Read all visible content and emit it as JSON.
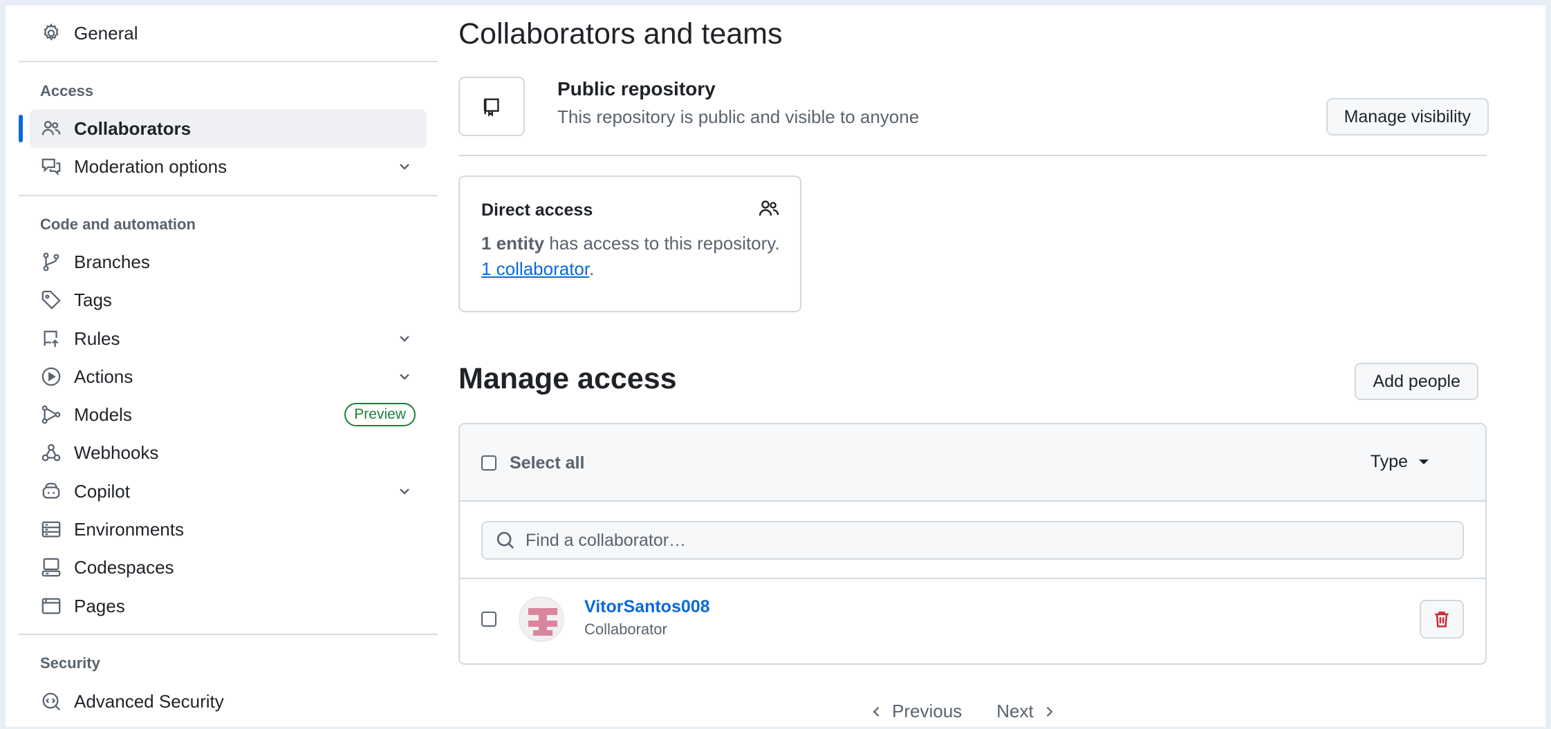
{
  "sidebar": {
    "general": {
      "label": "General",
      "icon": "gear-icon"
    },
    "sections": {
      "access": "Access",
      "code_automation": "Code and automation",
      "security": "Security"
    },
    "access_items": [
      {
        "label": "Collaborators",
        "icon": "people-icon",
        "active": true
      },
      {
        "label": "Moderation options",
        "icon": "comment-discussion-icon",
        "expandable": true
      }
    ],
    "code_items": [
      {
        "label": "Branches",
        "icon": "git-branch-icon"
      },
      {
        "label": "Tags",
        "icon": "tag-icon"
      },
      {
        "label": "Rules",
        "icon": "repo-push-icon",
        "expandable": true
      },
      {
        "label": "Actions",
        "icon": "play-icon",
        "expandable": true
      },
      {
        "label": "Models",
        "icon": "workflow-icon",
        "badge": "Preview"
      },
      {
        "label": "Webhooks",
        "icon": "webhook-icon"
      },
      {
        "label": "Copilot",
        "icon": "copilot-icon",
        "expandable": true
      },
      {
        "label": "Environments",
        "icon": "server-icon"
      },
      {
        "label": "Codespaces",
        "icon": "codespaces-icon"
      },
      {
        "label": "Pages",
        "icon": "browser-icon"
      }
    ],
    "security_items": [
      {
        "label": "Advanced Security",
        "icon": "codescan-icon"
      }
    ]
  },
  "main": {
    "title": "Collaborators and teams",
    "visibility": {
      "title": "Public repository",
      "description": "This repository is public and visible to anyone",
      "button": "Manage visibility"
    },
    "direct_access": {
      "title": "Direct access",
      "entity_count": "1 entity",
      "text_middle": " has access to this repository. ",
      "link": "1 collaborator",
      "text_end": "."
    },
    "manage_access": {
      "title": "Manage access",
      "add_button": "Add people",
      "select_all": "Select all",
      "type_filter": "Type",
      "search_placeholder": "Find a collaborator…",
      "collaborators": [
        {
          "name": "VitorSantos008",
          "role": "Collaborator"
        }
      ]
    },
    "pagination": {
      "previous": "Previous",
      "next": "Next"
    }
  },
  "colors": {
    "accent": "#0969da",
    "active_bar": "#0969da",
    "badge_green": "#1a7f37",
    "danger": "#d1242f",
    "avatar_pink": "#d9869d"
  }
}
